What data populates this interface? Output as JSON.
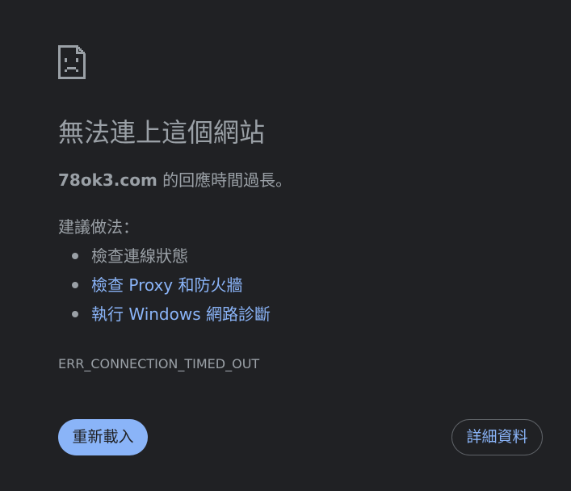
{
  "error": {
    "icon": "sad-document-icon",
    "title": "無法連上這個網站",
    "host": "78ok3.com",
    "message_suffix": " 的回應時間過長。",
    "suggestions_heading": "建議做法：",
    "suggestions": [
      {
        "label": "檢查連線狀態",
        "is_link": false
      },
      {
        "label": "檢查 Proxy 和防火牆",
        "is_link": true
      },
      {
        "label": "執行 Windows 網路診斷",
        "is_link": true
      }
    ],
    "code": "ERR_CONNECTION_TIMED_OUT"
  },
  "buttons": {
    "reload_label": "重新載入",
    "details_label": "詳細資料"
  },
  "colors": {
    "background": "#202124",
    "text": "#9aa0a6",
    "link": "#8ab4f8",
    "primary_button": "#8ab4f8",
    "button_border": "#5f6368"
  }
}
